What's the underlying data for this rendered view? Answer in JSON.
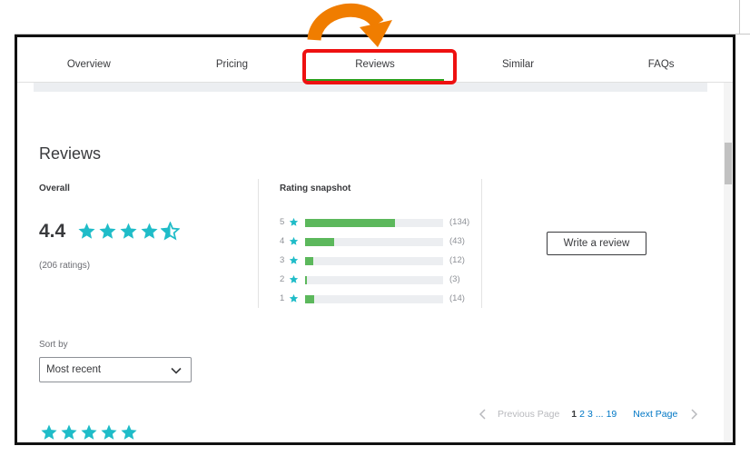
{
  "tabs": [
    {
      "label": "Overview"
    },
    {
      "label": "Pricing"
    },
    {
      "label": "Reviews",
      "active": true
    },
    {
      "label": "Similar"
    },
    {
      "label": "FAQs"
    }
  ],
  "reviews": {
    "title": "Reviews",
    "overall": {
      "label": "Overall",
      "score": "4.4",
      "star_rating": 4.4,
      "ratings_count": "(206 ratings)"
    },
    "snapshot": {
      "label": "Rating snapshot",
      "rows": [
        {
          "stars": "5",
          "count": "(134)",
          "value": 134
        },
        {
          "stars": "4",
          "count": "(43)",
          "value": 43
        },
        {
          "stars": "3",
          "count": "(12)",
          "value": 12
        },
        {
          "stars": "2",
          "count": "(3)",
          "value": 3
        },
        {
          "stars": "1",
          "count": "(14)",
          "value": 14
        }
      ]
    },
    "write_review_label": "Write a review",
    "sort": {
      "label": "Sort by",
      "selected": "Most recent"
    },
    "pagination": {
      "previous": "Previous Page",
      "current": "1",
      "pages": [
        "2",
        "3"
      ],
      "ellipsis": "...",
      "last": "19",
      "next": "Next Page"
    },
    "first_review_stars": 5
  },
  "colors": {
    "star_teal": "#1fbcc8",
    "bar_green": "#5cb85c",
    "tab_underline_green": "#2ca01c",
    "annotation_red": "#ee1111",
    "annotation_orange": "#f07d00",
    "link_blue": "#0077c5"
  },
  "icons": {
    "star": "star-icon",
    "half_star": "half-star-icon",
    "chevron_down": "chevron-down-icon",
    "chevron_left": "chevron-left-icon",
    "chevron_right": "chevron-right-icon",
    "annotation_arrow": "curved-arrow-icon"
  }
}
